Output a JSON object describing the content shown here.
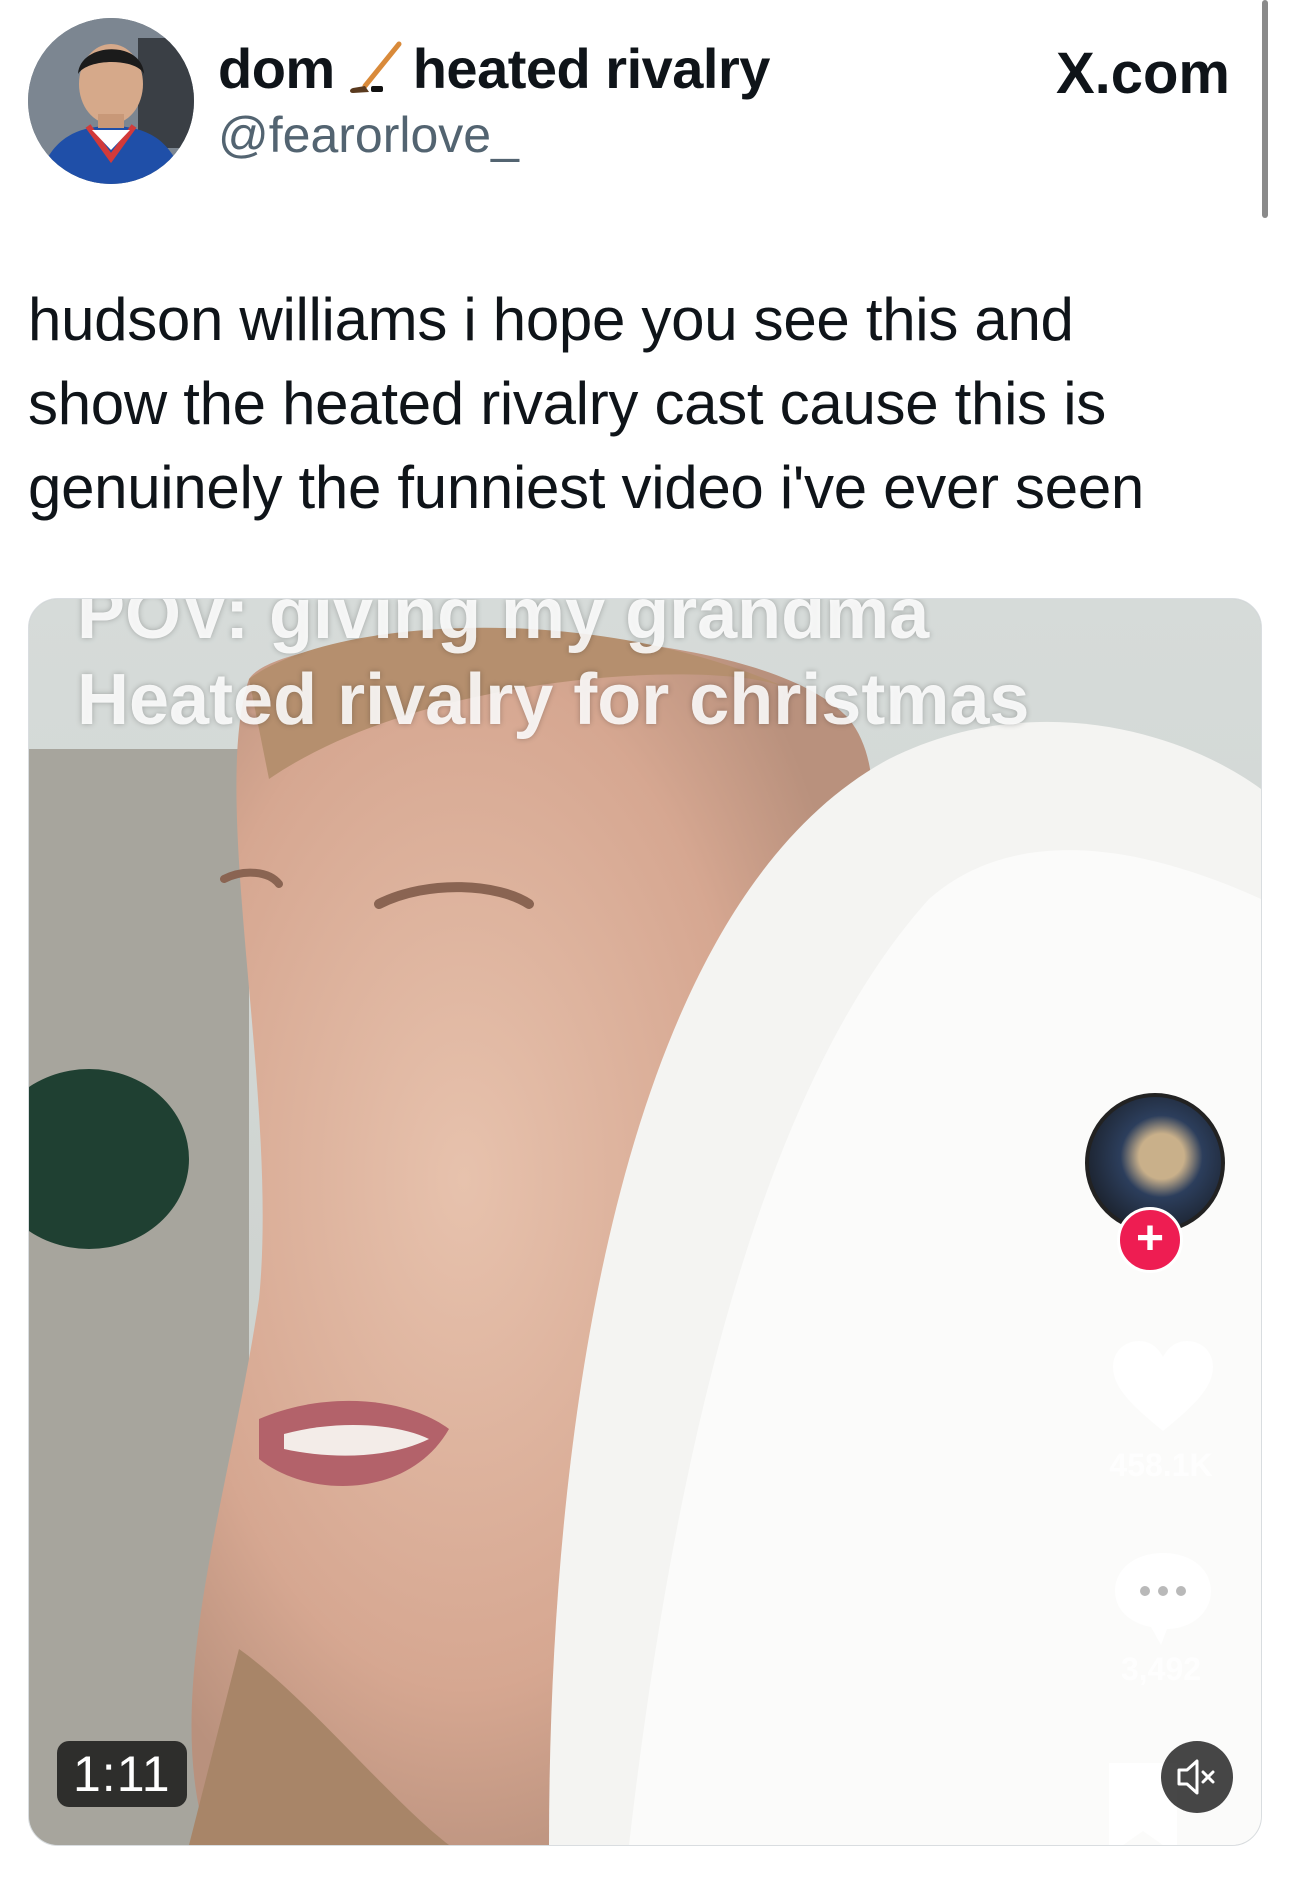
{
  "header": {
    "display_name_part1": "dom",
    "display_name_part2": "heated rivalry",
    "name_emoji_icon": "hockey-stick-icon",
    "handle": "@fearorlove_",
    "site_label": "X.com"
  },
  "tweet": {
    "text": "hudson williams i hope you see this and show the heated rivalry cast cause this is genuinely the funniest video i've ever seen"
  },
  "video": {
    "overlay_line1": "POV: giving my grandma",
    "overlay_line2": "Heated rivalry for christmas",
    "like_count": "458.1K",
    "comment_count": "3,492",
    "duration": "1:11",
    "follow_symbol": "+",
    "icons": [
      "heart-icon",
      "comment-icon",
      "bookmark-icon",
      "mute-icon"
    ]
  }
}
